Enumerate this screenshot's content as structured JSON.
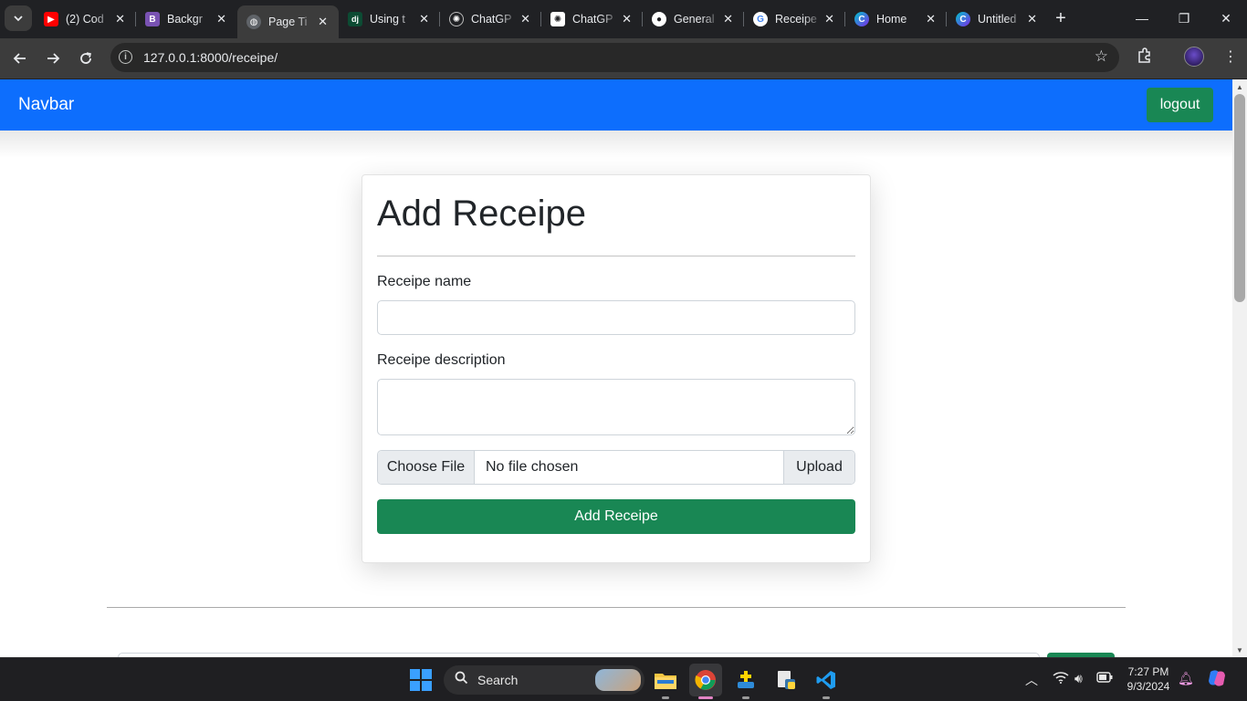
{
  "browser": {
    "tabs": [
      {
        "title": "(2) Cod",
        "favicon": "youtube-icon",
        "color": "#ff0000"
      },
      {
        "title": "Backgr",
        "favicon": "bootstrap-icon",
        "color": "#7952b3"
      },
      {
        "title": "Page Ti",
        "favicon": "globe-icon",
        "color": "#5f6368"
      },
      {
        "title": "Using t",
        "favicon": "django-icon",
        "color": "#0c4b33"
      },
      {
        "title": "ChatGP",
        "favicon": "openai-icon",
        "color": "#202124"
      },
      {
        "title": "ChatGP",
        "favicon": "openai-icon",
        "color": "#ffffff"
      },
      {
        "title": "General",
        "favicon": "github-icon",
        "color": "#202124"
      },
      {
        "title": "Receipe",
        "favicon": "google-icon",
        "color": "#ffffff"
      },
      {
        "title": "Home",
        "favicon": "canva-icon",
        "color": "#7d2ae8"
      },
      {
        "title": "Untitled",
        "favicon": "canva-icon",
        "color": "#7d2ae8"
      }
    ],
    "active_tab": 2,
    "url": "127.0.0.1:8000/receipe/"
  },
  "navbar": {
    "brand": "Navbar",
    "logout_label": "logout",
    "bg_color": "#0d6efd",
    "button_color": "#198754"
  },
  "form": {
    "heading": "Add Receipe",
    "name_label": "Receipe name",
    "name_value": "",
    "description_label": "Receipe description",
    "description_value": "",
    "choose_file_label": "Choose File",
    "no_file_text": "No file chosen",
    "upload_label": "Upload",
    "submit_label": "Add Receipe"
  },
  "taskbar": {
    "search_placeholder": "Search",
    "time": "7:27 PM",
    "date": "9/3/2024"
  }
}
